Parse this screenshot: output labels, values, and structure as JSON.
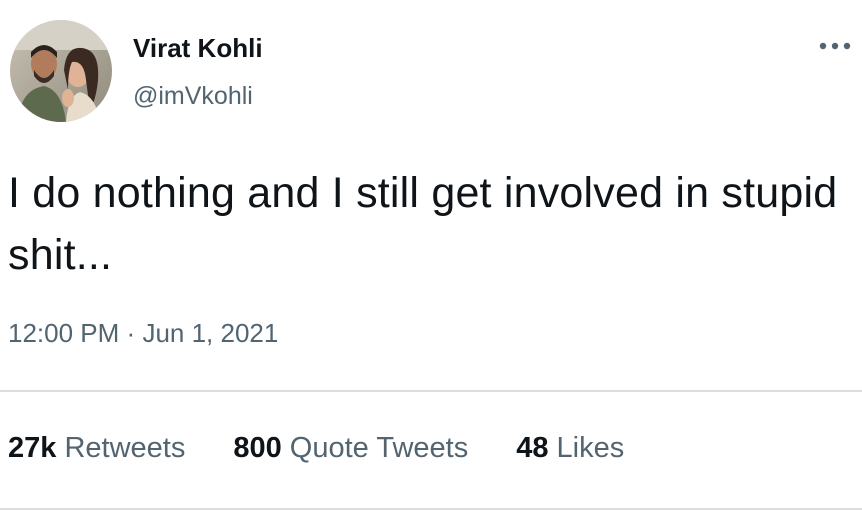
{
  "user": {
    "display_name": "Virat Kohli",
    "handle": "@imVkohli",
    "avatar_icon": "profile-photo-avatar"
  },
  "tweet": {
    "text": "I do nothing and I still get involved in stupid shit...",
    "time": "12:00 PM",
    "separator": "·",
    "date": "Jun 1, 2021"
  },
  "stats": {
    "retweets_count": "27k",
    "retweets_label": "Retweets",
    "quotes_count": "800",
    "quotes_label": "Quote Tweets",
    "likes_count": "48",
    "likes_label": "Likes"
  },
  "menu": {
    "icon": "more-horizontal-icon"
  },
  "colors": {
    "text_primary": "#0f1419",
    "text_secondary": "#536471",
    "divider": "#d9dee2"
  }
}
